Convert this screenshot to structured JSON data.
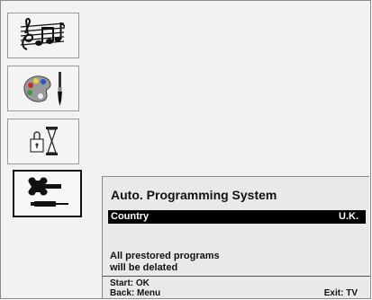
{
  "menu": {
    "items": [
      {
        "name": "sound",
        "icon": "music-score-icon"
      },
      {
        "name": "picture",
        "icon": "palette-brush-icon"
      },
      {
        "name": "timer",
        "icon": "lock-hourglass-icon"
      },
      {
        "name": "setup",
        "icon": "wrench-screwdriver-icon",
        "selected": true
      }
    ]
  },
  "panel": {
    "title": "Auto. Programming System",
    "country_label": "Country",
    "country_value": "U.K.",
    "message_line1": "All prestored programs",
    "message_line2": "will be delated",
    "start_hint": "Start: OK",
    "back_hint": "Back: Menu",
    "exit_hint": "Exit: TV"
  },
  "colors": {
    "background": "#f2f2f2",
    "highlight": "#000000",
    "text": "#111111"
  }
}
